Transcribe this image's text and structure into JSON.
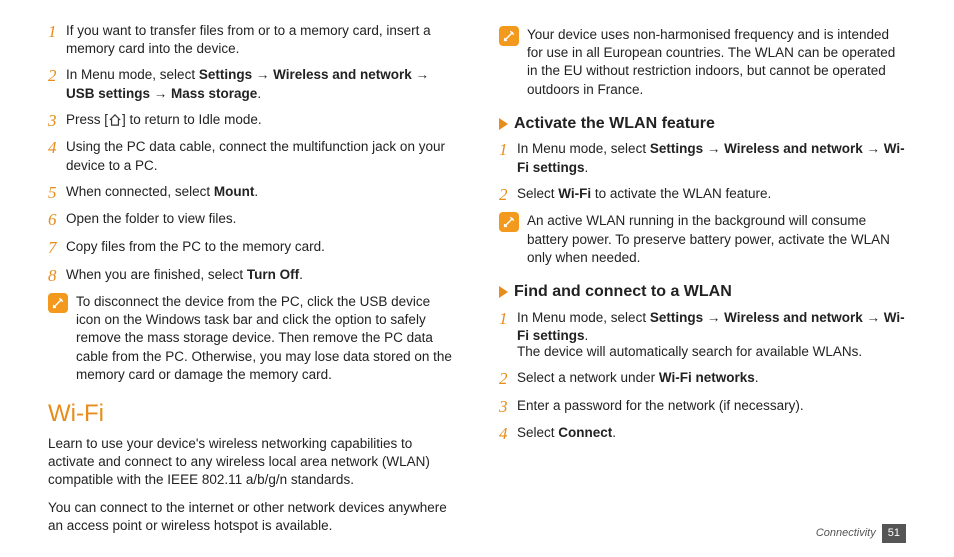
{
  "left": {
    "steps": [
      {
        "n": "1",
        "text": "If you want to transfer files from or to a memory card, insert a memory card into the device."
      },
      {
        "n": "2",
        "pre": "In Menu mode, select ",
        "bold": "Settings → Wireless and network → USB settings → Mass storage",
        "post": "."
      },
      {
        "n": "3",
        "pre": "Press [",
        "post": "] to return to Idle mode."
      },
      {
        "n": "4",
        "text": "Using the PC data cable, connect the multifunction jack on your device to a PC."
      },
      {
        "n": "5",
        "pre": "When connected, select ",
        "bold": "Mount",
        "post": "."
      },
      {
        "n": "6",
        "text": "Open the folder to view files."
      },
      {
        "n": "7",
        "text": "Copy files from the PC to the memory card."
      },
      {
        "n": "8",
        "pre": "When you are finished, select ",
        "bold": "Turn Off",
        "post": "."
      }
    ],
    "note": "To disconnect the device from the PC, click the USB device icon on the Windows task bar and click the option to safely remove the mass storage device. Then remove the PC data cable from the PC. Otherwise, you may lose data stored on the memory card or damage the memory card.",
    "wifi_title": "Wi-Fi",
    "wifi_p1": "Learn to use your device's wireless networking capabilities to activate and connect to any wireless local area network (WLAN) compatible with the IEEE 802.11 a/b/g/n standards.",
    "wifi_p2": "You can connect to the internet or other network devices anywhere an access point or wireless hotspot is available."
  },
  "right": {
    "top_note": "Your device uses non-harmonised frequency and is intended for use in all European countries. The WLAN can be operated in the EU without restriction indoors, but cannot be operated outdoors in France.",
    "sec1_title": "Activate the WLAN feature",
    "sec1_steps": [
      {
        "n": "1",
        "pre": "In Menu mode, select ",
        "bold": "Settings → Wireless and network → Wi-Fi settings",
        "post": "."
      },
      {
        "n": "2",
        "pre": "Select ",
        "bold": "Wi-Fi",
        "post": " to activate the WLAN feature."
      }
    ],
    "sec1_note": "An active WLAN running in the background will consume battery power. To preserve battery power, activate the WLAN only when needed.",
    "sec2_title": "Find and connect to a WLAN",
    "sec2_steps": [
      {
        "n": "1",
        "pre": "In Menu mode, select ",
        "bold": "Settings → Wireless and network → Wi-Fi settings",
        "post": "."
      },
      {
        "n": "2",
        "pre": "Select a network under ",
        "bold": "Wi-Fi networks",
        "post": "."
      },
      {
        "n": "3",
        "text": "Enter a password for the network (if necessary)."
      },
      {
        "n": "4",
        "pre": "Select ",
        "bold": "Connect",
        "post": "."
      }
    ],
    "sec2_extra": "The device will automatically search for available WLANs."
  },
  "footer": {
    "section": "Connectivity",
    "page": "51"
  }
}
